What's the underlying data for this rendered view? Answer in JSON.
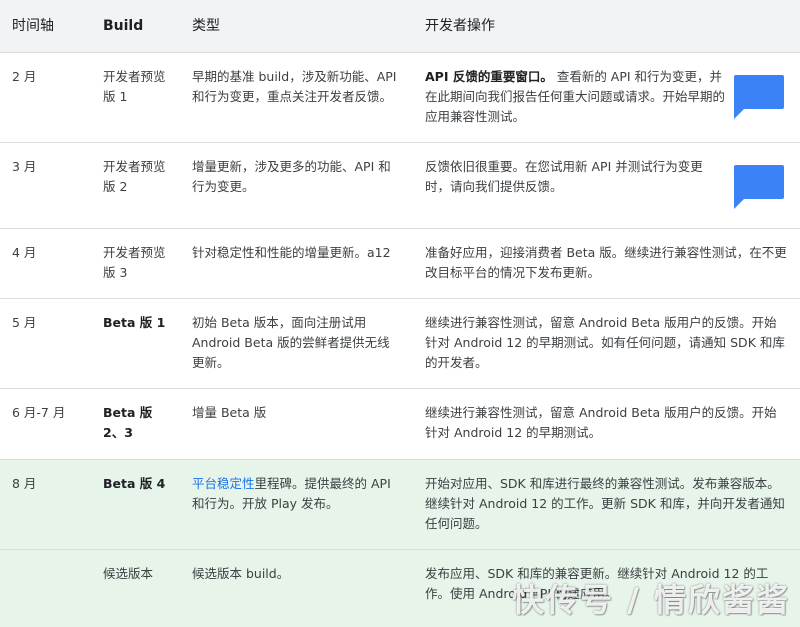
{
  "table": {
    "headers": [
      "时间轴",
      "Build",
      "类型",
      "开发者操作"
    ],
    "rows": [
      {
        "timeline": "2 月",
        "build": "开发者预览版 1",
        "type": "早期的基准 build，涉及新功能、API 和行为变更，重点关注开发者反馈。",
        "action_bold": "API 反馈的重要窗口。",
        "action": " 查看新的 API 和行为变更，并在此期间向我们报告任何重大问题或请求。开始早期的应用兼容性测试。",
        "feedback_icon": "feedback-icon"
      },
      {
        "timeline": "3 月",
        "build": "开发者预览版 2",
        "type": "增量更新，涉及更多的功能、API 和行为变更。",
        "action": "反馈依旧很重要。在您试用新 API 并测试行为变更时，请向我们提供反馈。",
        "feedback_icon": "feedback-icon"
      },
      {
        "timeline": "4 月",
        "build": "开发者预览版 3",
        "type": "针对稳定性和性能的增量更新。a12",
        "action": "准备好应用，迎接消费者 Beta 版。继续进行兼容性测试，在不更改目标平台的情况下发布更新。"
      },
      {
        "timeline": "5 月",
        "build": "Beta 版 1",
        "type": "初始 Beta 版本，面向注册试用 Android Beta 版的尝鲜者提供无线更新。",
        "action": "继续进行兼容性测试，留意 Android Beta 版用户的反馈。开始针对 Android 12 的早期测试。如有任何问题，请通知 SDK 和库的开发者。"
      },
      {
        "timeline": "6 月-7 月",
        "build": "Beta 版 2、3",
        "type": "增量 Beta 版",
        "action": "继续进行兼容性测试，留意 Android Beta 版用户的反馈。开始针对 Android 12 的早期测试。"
      },
      {
        "timeline": "8 月",
        "build": "Beta 版 4",
        "type_link": "平台稳定性",
        "type": "里程碑。提供最终的 API 和行为。开放 Play 发布。",
        "action": "开始对应用、SDK 和库进行最终的兼容性测试。发布兼容版本。继续针对 Android 12 的工作。更新 SDK 和库，并向开发者通知任何问题。"
      },
      {
        "timeline": "",
        "build": "候选版本",
        "type": "候选版本 build。",
        "action": "发布应用、SDK 和库的兼容更新。继续针对 Android 12 的工作。使用 Android API 构建应用。"
      }
    ]
  },
  "watermark": "快传号 / 情欣酱酱",
  "colors": {
    "header_bg": "#f1f3f4",
    "highlight_row_bg": "#e6f4ea",
    "link": "#1a73e8",
    "feedback_icon": "#3b82f6"
  }
}
